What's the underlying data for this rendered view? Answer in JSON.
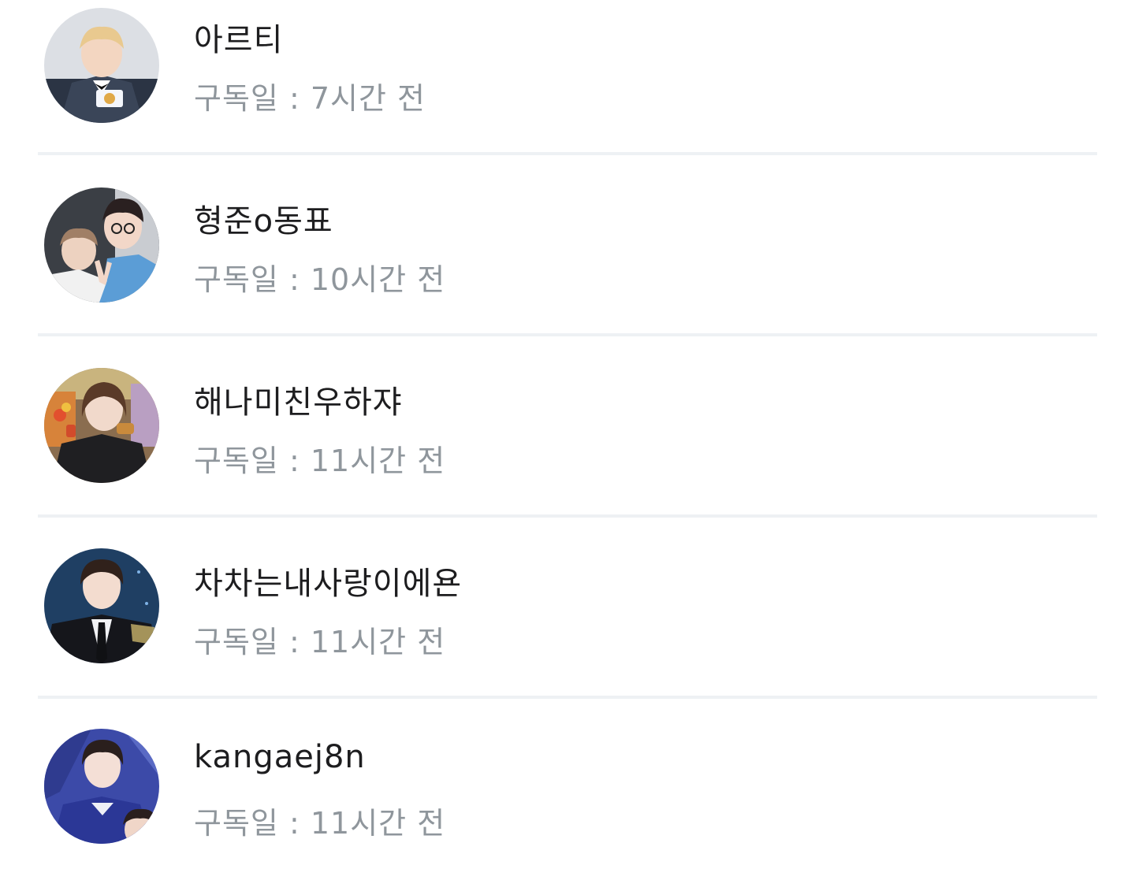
{
  "subscribers": [
    {
      "name": "아르티",
      "subscribed_label": "구독일 : 7시간 전"
    },
    {
      "name": "형준o동표",
      "subscribed_label": "구독일 : 10시간 전"
    },
    {
      "name": "해나미친우하쟈",
      "subscribed_label": "구독일 : 11시간 전"
    },
    {
      "name": "차차는내사랑이에욘",
      "subscribed_label": "구독일 : 11시간 전"
    },
    {
      "name": "kangaej8n",
      "subscribed_label": "구독일 : 11시간 전"
    }
  ]
}
